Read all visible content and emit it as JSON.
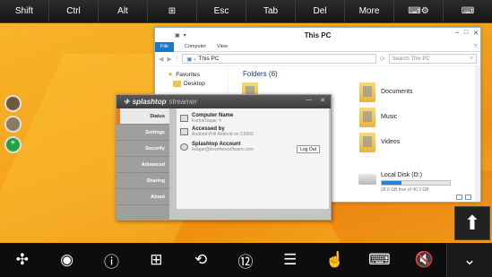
{
  "keybar": {
    "keys": [
      "Shift",
      "Ctrl",
      "Alt",
      "⊞",
      "Esc",
      "Tab",
      "Del",
      "More",
      "⌨⚙",
      "⌨"
    ]
  },
  "explorer": {
    "title": "This PC",
    "tabs": [
      "File",
      "Computer",
      "View"
    ],
    "address": "This PC",
    "search_placeholder": "Search This PC",
    "nav": [
      "Favorites",
      "Desktop"
    ],
    "folders_header": "Folders (6)",
    "folders": [
      "Documents",
      "Music",
      "Videos"
    ],
    "drive": {
      "label": "Local Disk (D:)",
      "free_text": "28.6 GB free of 40.3 GB",
      "used_fraction": 0.29
    }
  },
  "splashtop": {
    "logo": "splashtop",
    "logo_suffix": "streamer",
    "tabs": [
      "Status",
      "Settings",
      "Security",
      "Advanced",
      "Sharing",
      "About"
    ],
    "computer_name_label": "Computer Name",
    "computer_name_value": "KumarSagar",
    "accessed_by_label": "Accessed by",
    "accessed_by_value": "Android-Poll Android on C6603",
    "account_label": "Splashtop Account",
    "account_value": "ksagar@ilovefreesoftware.com",
    "logout_label": "Log Out"
  },
  "toolbar": {
    "icons": [
      "cross-arrows-icon",
      "record-icon",
      "help-icon",
      "windows-icon",
      "rotation-lock-icon",
      "numbers-icon",
      "menu-icon",
      "touch-icon",
      "keyboard-icon",
      "mute-icon",
      "chevron-down-icon"
    ]
  },
  "accent": "#f07a1a"
}
